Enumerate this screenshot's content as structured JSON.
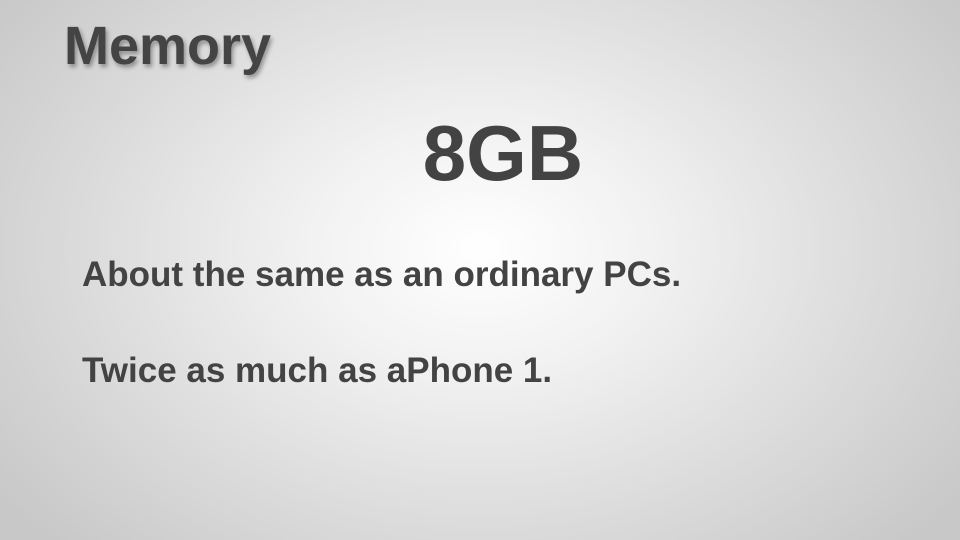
{
  "slide": {
    "title": "Memory",
    "headline": "8GB",
    "body": [
      "About the same as an ordinary PCs.",
      "Twice as much as aPhone 1."
    ]
  },
  "colors": {
    "text": "#434343",
    "background_center": "#ffffff",
    "background_edge": "#c8c8c8"
  }
}
